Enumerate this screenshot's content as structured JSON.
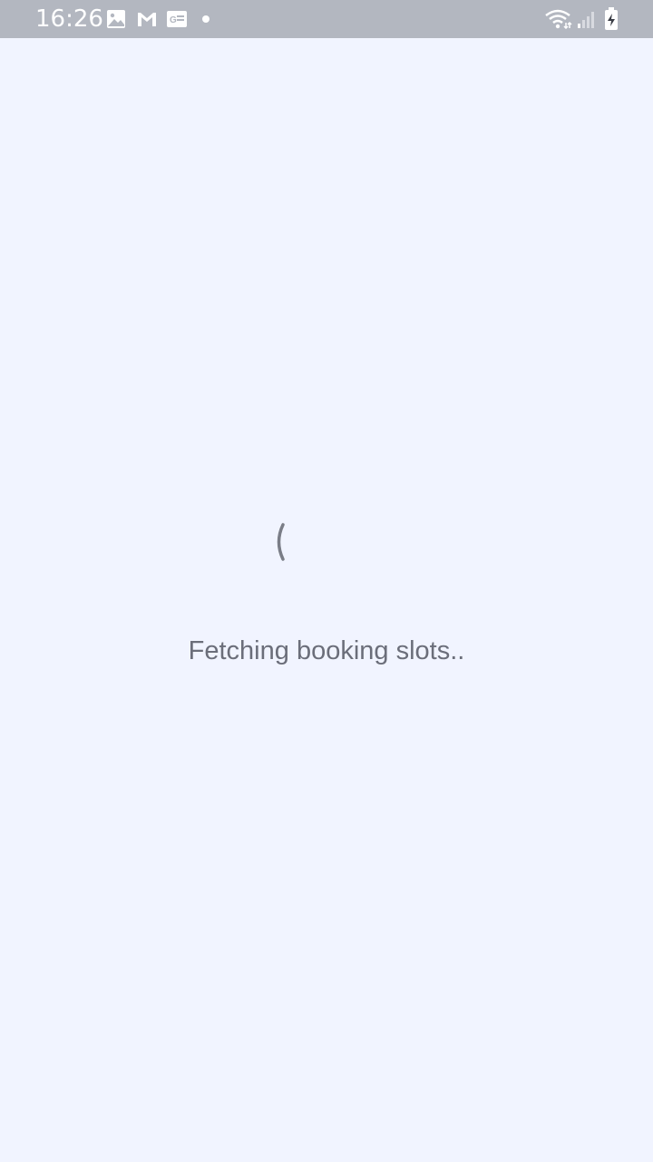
{
  "status_bar": {
    "time": "16:26",
    "background_color": "#b3b7c0",
    "notification_icons": [
      "gallery-icon",
      "gmail-icon",
      "google-news-icon",
      "more-notifications-dot-icon"
    ],
    "system_icons": [
      "wifi-icon",
      "signal-icon",
      "battery-charging-icon"
    ]
  },
  "page": {
    "background_color": "#f1f4ff",
    "loading_text": "Fetching booking slots..",
    "text_color": "#6b6e7a",
    "spinner_color": "#7a7d87"
  }
}
